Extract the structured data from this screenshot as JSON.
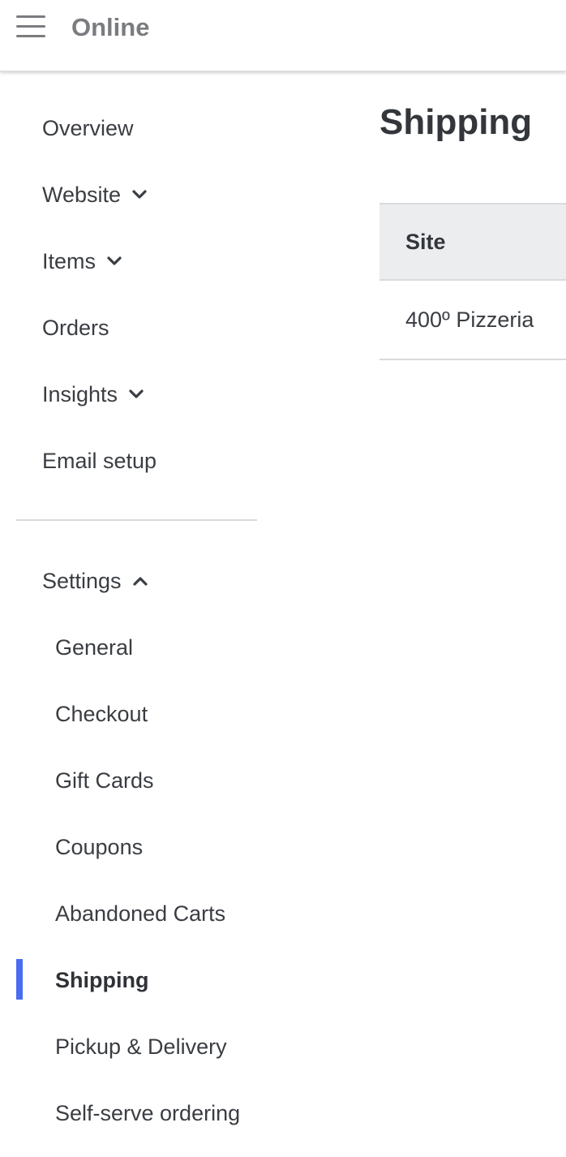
{
  "header": {
    "title": "Online",
    "menu_icon": "hamburger-menu-icon"
  },
  "sidebar": {
    "items": [
      {
        "label": "Overview"
      },
      {
        "label": "Website",
        "icon": "chevron-down-icon"
      },
      {
        "label": "Items",
        "icon": "chevron-down-icon"
      },
      {
        "label": "Orders"
      },
      {
        "label": "Insights",
        "icon": "chevron-down-icon"
      },
      {
        "label": "Email setup"
      }
    ],
    "settings": {
      "label": "Settings",
      "icon": "chevron-up-icon",
      "subitems": [
        {
          "label": "General"
        },
        {
          "label": "Checkout"
        },
        {
          "label": "Gift Cards"
        },
        {
          "label": "Coupons"
        },
        {
          "label": "Abandoned Carts"
        },
        {
          "label": "Shipping",
          "active": true
        },
        {
          "label": "Pickup & Delivery"
        },
        {
          "label": "Self-serve ordering"
        }
      ]
    }
  },
  "main": {
    "title": "Shipping",
    "table": {
      "columns": [
        "Site"
      ],
      "rows": [
        [
          "400º Pizzeria"
        ]
      ]
    }
  },
  "colors": {
    "accent": "#4a6cf0",
    "header_text": "#7a7c80",
    "text": "#3a3d42",
    "table_header_bg": "#ecedef"
  }
}
